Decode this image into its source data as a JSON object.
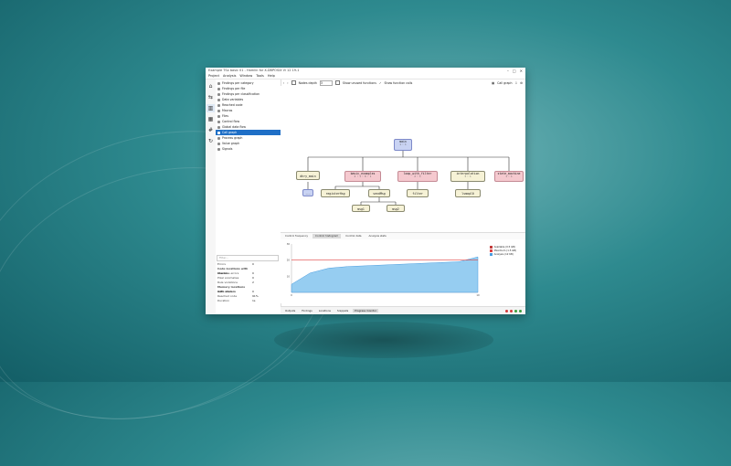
{
  "window": {
    "title": "Example TSx basic 01 - Hamlin for X-DBPOSIX Vi 12 19-1",
    "controls": [
      "–",
      "□",
      "✕"
    ]
  },
  "menu": [
    "Project",
    "Analysis",
    "Window",
    "Tools",
    "Help"
  ],
  "iconbar": [
    {
      "icon": "home-icon",
      "glyph": "⌂"
    },
    {
      "icon": "arrows-icon",
      "glyph": "⇆"
    },
    {
      "icon": "chart-icon",
      "glyph": "▥"
    },
    {
      "icon": "grid-icon",
      "glyph": "▦"
    },
    {
      "icon": "hash-icon",
      "glyph": "#"
    },
    {
      "icon": "refresh-icon",
      "glyph": "↻"
    }
  ],
  "nav": {
    "items": [
      "Findings per category",
      "Findings per file",
      "Findings per classification",
      "Data variables",
      "Reached code",
      "Macros",
      "Files",
      "Control flow",
      "Global data flow",
      "Call graph",
      "Process graph",
      "Value graph",
      "Signals"
    ],
    "selected_index": 9,
    "filter_placeholder": "Filter..."
  },
  "stats": [
    {
      "k": "Errors",
      "v": "0",
      "head": false
    },
    {
      "k": "Code locations with stamm",
      "v": "",
      "head": true
    },
    {
      "k": "Run time errors",
      "v": "0",
      "head": false
    },
    {
      "k": "Pixel anomalies",
      "v": "0",
      "head": false
    },
    {
      "k": "Rule violations",
      "v": "2",
      "head": false
    },
    {
      "k": "Memory locations with stamm",
      "v": "",
      "head": true
    },
    {
      "k": "Data reads",
      "v": "0",
      "head": false
    },
    {
      "k": "Reached code",
      "v": "91%",
      "head": false
    },
    {
      "k": "Duration",
      "v": "1s",
      "head": false
    }
  ],
  "toolbar": {
    "nav_back": "‹",
    "nav_fwd": "›",
    "depth_label": "Nodes depth",
    "depth_value": "3",
    "opt1": "Show unused functions",
    "opt2": "Show function calls",
    "action_label": "Call graph"
  },
  "graph": {
    "main": {
      "label": "main",
      "sub": "1 : 1"
    },
    "level1": [
      {
        "label": "dhry_main",
        "sub": "",
        "color": "yellow"
      },
      {
        "label": "basic_examples",
        "sub": "2 : 1 : 0 : 1",
        "color": "pink"
      },
      {
        "label": "loop_with_filter",
        "sub": "2 : 1",
        "color": "pink"
      },
      {
        "label": "interpolation",
        "sub": "1 : 1",
        "color": "yellow"
      },
      {
        "label": "state_machine",
        "sub": "1 : 1",
        "color": "pink"
      }
    ],
    "level2": [
      {
        "label": "...",
        "color": "blue"
      },
      {
        "label": "registerHsg",
        "color": "yellow"
      },
      {
        "label": "sendMsg",
        "color": "yellow"
      },
      {
        "label": "filter",
        "color": "yellow"
      },
      {
        "label": "lsmapl0",
        "color": "yellow"
      }
    ],
    "level3": [
      {
        "label": "msg1",
        "color": "yellow"
      },
      {
        "label": "msg2",
        "color": "yellow"
      }
    ]
  },
  "tabs": [
    "Control frequency",
    "Control histogram",
    "Control data",
    "Analysis stats"
  ],
  "active_tab": 1,
  "bottom_tabs": [
    "Outputs",
    "Findings",
    "Locations",
    "Snippets",
    "Progress monitor"
  ],
  "bottom_active": 4,
  "status_dots": [
    "#d33b3b",
    "#d33b3b",
    "#3b9e3b",
    "#3b9e3b"
  ],
  "chart_data": {
    "type": "area",
    "x": [
      0,
      1,
      2,
      3,
      4,
      5,
      6,
      7,
      8,
      9,
      10
    ],
    "series": [
      {
        "name": "Analysis (12 KB)",
        "values": [
          5,
          12,
          15,
          16,
          16.5,
          17,
          17.5,
          18,
          18.5,
          19,
          22
        ],
        "color": "#4a9de0"
      }
    ],
    "threshold": {
      "name": "Maximum (1.5 GB)",
      "value": 20,
      "color": "#e04040"
    },
    "legend": [
      {
        "name": "Available (0.5 GB)",
        "color": "#c23a3a"
      },
      {
        "name": "Maximum (1.5 GB)",
        "color": "#e04040"
      },
      {
        "name": "Analysis (12 KB)",
        "color": "#4a9de0"
      }
    ],
    "ylim": [
      0,
      30
    ],
    "yticks": [
      "30",
      "20",
      "10"
    ],
    "xticks": [
      "0",
      "10"
    ],
    "legend_position": "top-right"
  },
  "colors": {
    "accent": "#1f6fc6",
    "bg_dark": "#135e66",
    "bg_light": "#6fb3b6"
  }
}
